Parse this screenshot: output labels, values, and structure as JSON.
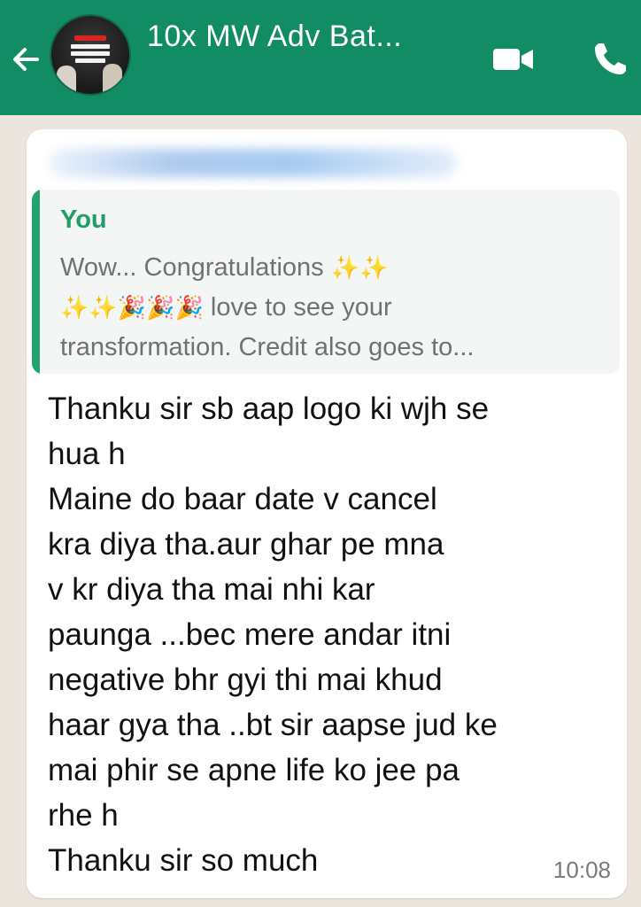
{
  "header": {
    "title": "10x MW Adv Bat...",
    "background_color": "#128c64",
    "back_icon": "back-arrow-icon",
    "avatar": {
      "brand_lines": [
        "MENTAL",
        "WELLNESS",
        "ADVANCE"
      ]
    },
    "actions": [
      {
        "name": "video-call",
        "icon": "video-camera-icon"
      },
      {
        "name": "voice-call",
        "icon": "phone-icon"
      }
    ]
  },
  "message": {
    "quoted": {
      "author": "You",
      "lines": [
        {
          "text": "Wow... Congratulations ",
          "emoji_after": [
            "sparkles",
            "sparkles"
          ]
        },
        {
          "emoji_before": [
            "sparkles",
            "sparkles",
            "party-popper",
            "party-popper",
            "party-popper"
          ],
          "text": " love to see your"
        },
        {
          "text": "transformation. Credit also goes to..."
        }
      ],
      "accent_color": "#25a36f"
    },
    "body_lines": [
      "Thanku sir sb aap logo ki wjh se",
      "hua h",
      "Maine do baar date v cancel",
      "kra diya tha.aur ghar pe mna",
      "v kr diya tha mai nhi kar",
      "paunga ...bec mere andar itni",
      "negative bhr gyi thi mai khud",
      "haar gya tha ..bt sir aapse jud ke",
      "mai phir se apne life ko jee pa",
      "rhe h",
      "Thanku sir so much"
    ],
    "time": "10:08"
  }
}
